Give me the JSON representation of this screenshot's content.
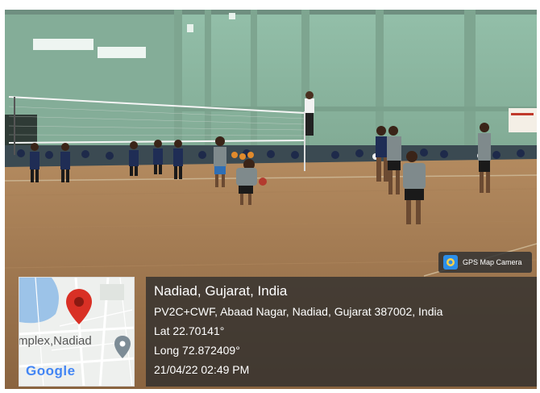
{
  "badge": {
    "text": "GPS Map Camera"
  },
  "map": {
    "place_label": "mplex,Nadiad",
    "logo": "Google"
  },
  "location": {
    "title": "Nadiad, Gujarat, India",
    "address": "PV2C+CWF, Abaad Nagar, Nadiad, Gujarat 387002, India",
    "lat": "Lat 22.70141°",
    "long": "Long 72.872409°",
    "datetime": "21/04/22 02:49 PM"
  },
  "colors": {
    "wall": "#8fb8a4",
    "floor": "#a07850",
    "jersey_grey": "#7f8a8c",
    "jersey_navy": "#1f2d55",
    "overlay": "#2d2d2d",
    "pin_red": "#d93025"
  }
}
